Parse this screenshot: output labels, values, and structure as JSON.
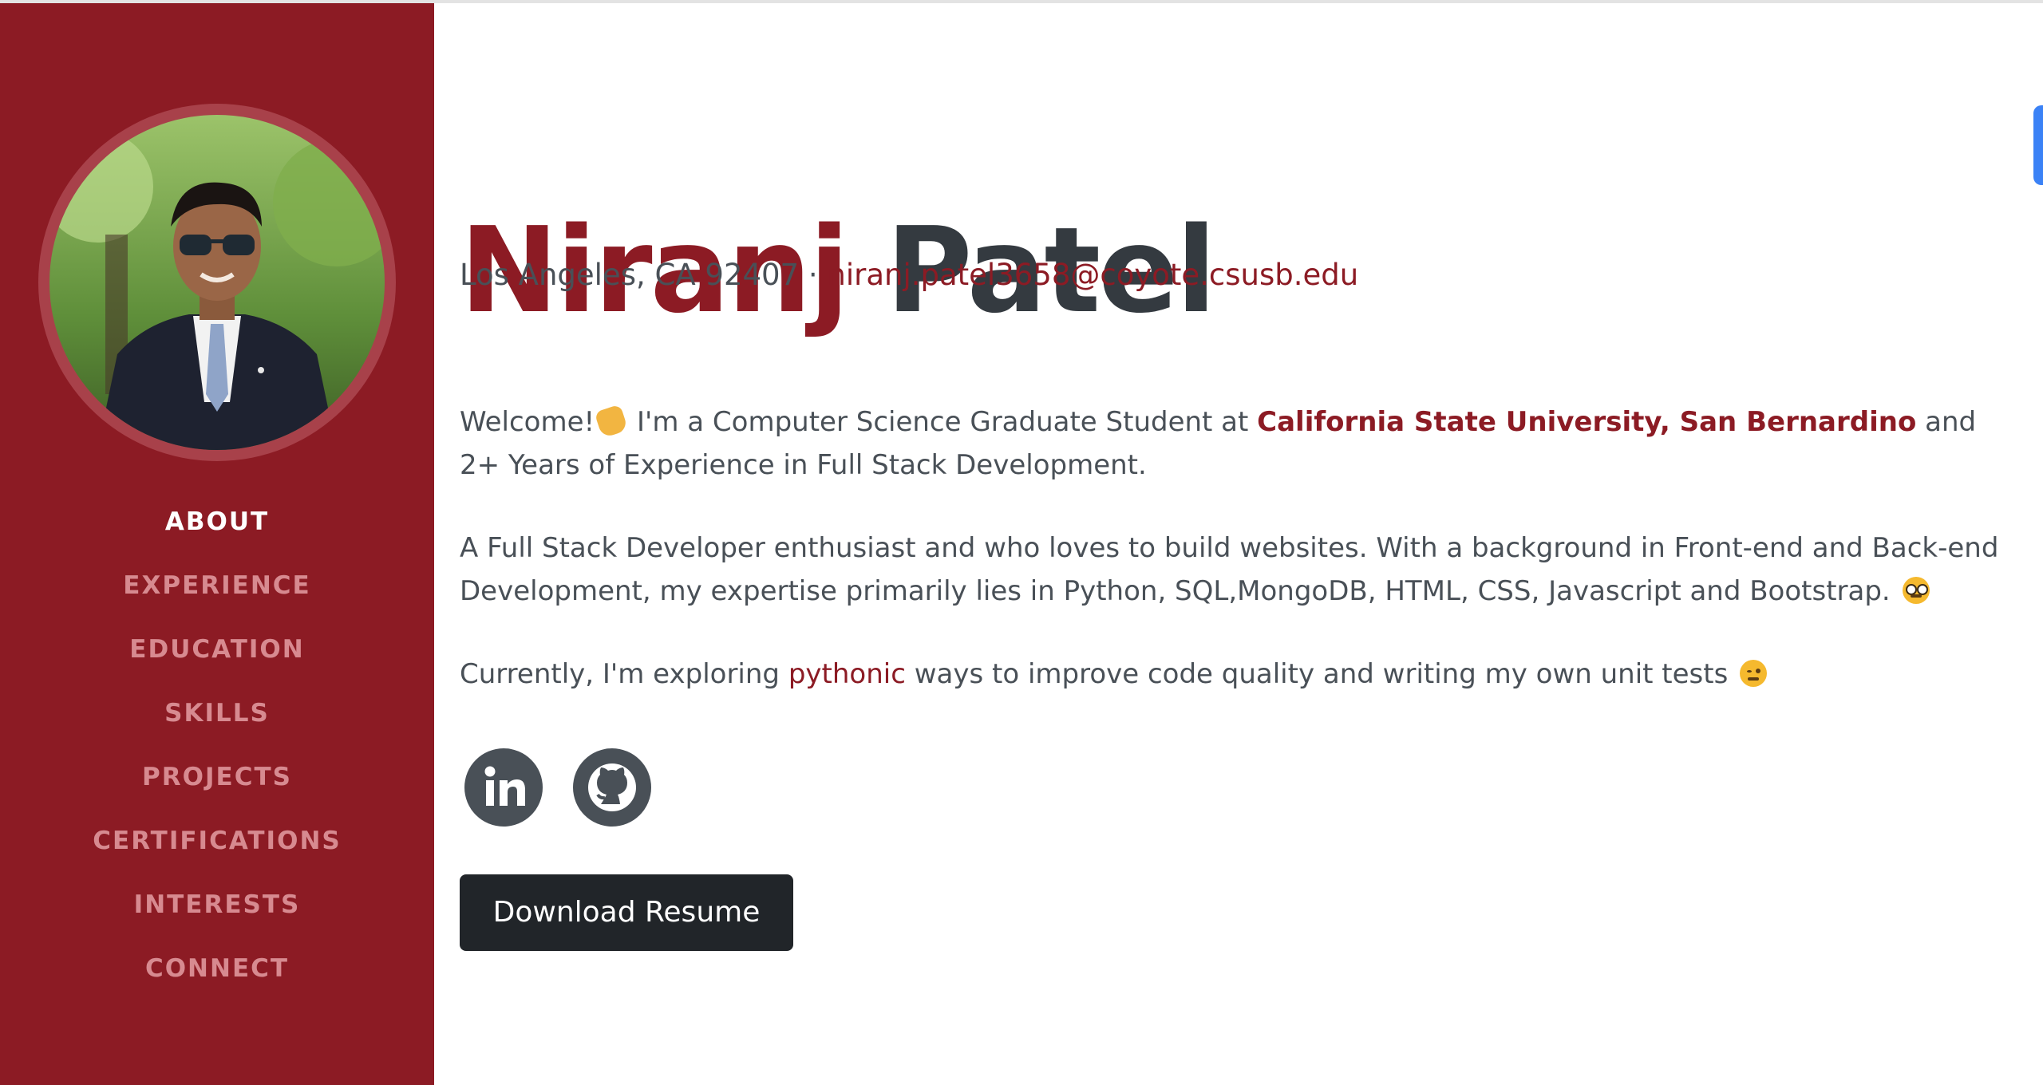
{
  "profile": {
    "first_name": "Niranj",
    "last_name": "Patel",
    "address": "Los Angeles, CA 92407 · ",
    "email": "niranj.patel3658@coyote.csusb.edu"
  },
  "nav": {
    "items": [
      "ABOUT",
      "EXPERIENCE",
      "EDUCATION",
      "SKILLS",
      "PROJECTS",
      "CERTIFICATIONS",
      "INTERESTS",
      "CONNECT"
    ],
    "active": "ABOUT"
  },
  "about": {
    "p1_a": "Welcome!",
    "p1_b": " I'm a Computer Science Graduate Student at ",
    "university": "California State University, San Bernardino",
    "p1_c": " and 2+ Years of Experience in Full Stack Development.",
    "p2": "A Full Stack Developer enthusiast and who loves to build websites. With a background in Front-end and Back-end Development, my expertise primarily lies in Python, SQL,MongoDB, HTML, CSS, Javascript and Bootstrap. ",
    "p3_a": "Currently, I'm exploring ",
    "p3_highlight": "pythonic",
    "p3_b": " ways to improve code quality and writing my own unit tests "
  },
  "social": [
    {
      "name": "LinkedIn",
      "icon": "linkedin-icon"
    },
    {
      "name": "GitHub",
      "icon": "github-icon"
    }
  ],
  "actions": {
    "download_label": "Download Resume"
  },
  "colors": {
    "brand": "#8c1b24",
    "text": "#495057",
    "heading": "#343a40",
    "button": "#212529",
    "nav_inactive": "#d78a90"
  }
}
